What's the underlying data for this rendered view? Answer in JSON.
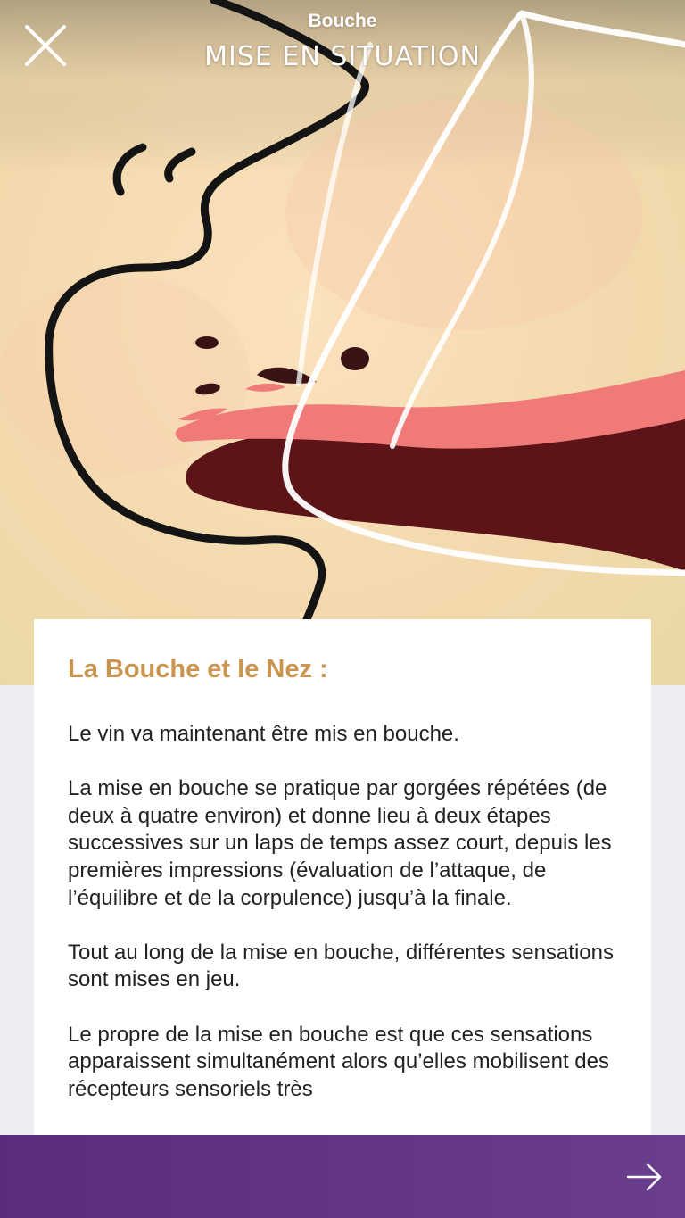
{
  "header": {
    "section": "Bouche",
    "title": "Mise en situation"
  },
  "content": {
    "title": "La Bouche et le Nez :",
    "paragraphs": [
      "Le vin va maintenant être mis en bouche.",
      "La mise en bouche se pratique par gorgées répétées (de deux à quatre environ) et donne lieu à deux étapes successives sur un laps de temps assez court, depuis les premières impressions (évaluation de l’attaque, de l’équilibre et de la corpulence) jusqu’à la finale.",
      "Tout au long de la mise en bouche, différentes sensations sont mises en jeu.",
      "Le propre de la mise en bouche est que ces sensations apparaissent simultanément alors qu’elles mobilisent des récepteurs sensoriels très"
    ]
  },
  "icons": {
    "close": "close-icon",
    "next": "arrow-right-icon"
  },
  "colors": {
    "accent_title": "#c9954f",
    "footer": "#5a2d7a",
    "illustration_background": "#f3dcb2",
    "wine": "#5c1418",
    "lips": "#f07a78"
  }
}
